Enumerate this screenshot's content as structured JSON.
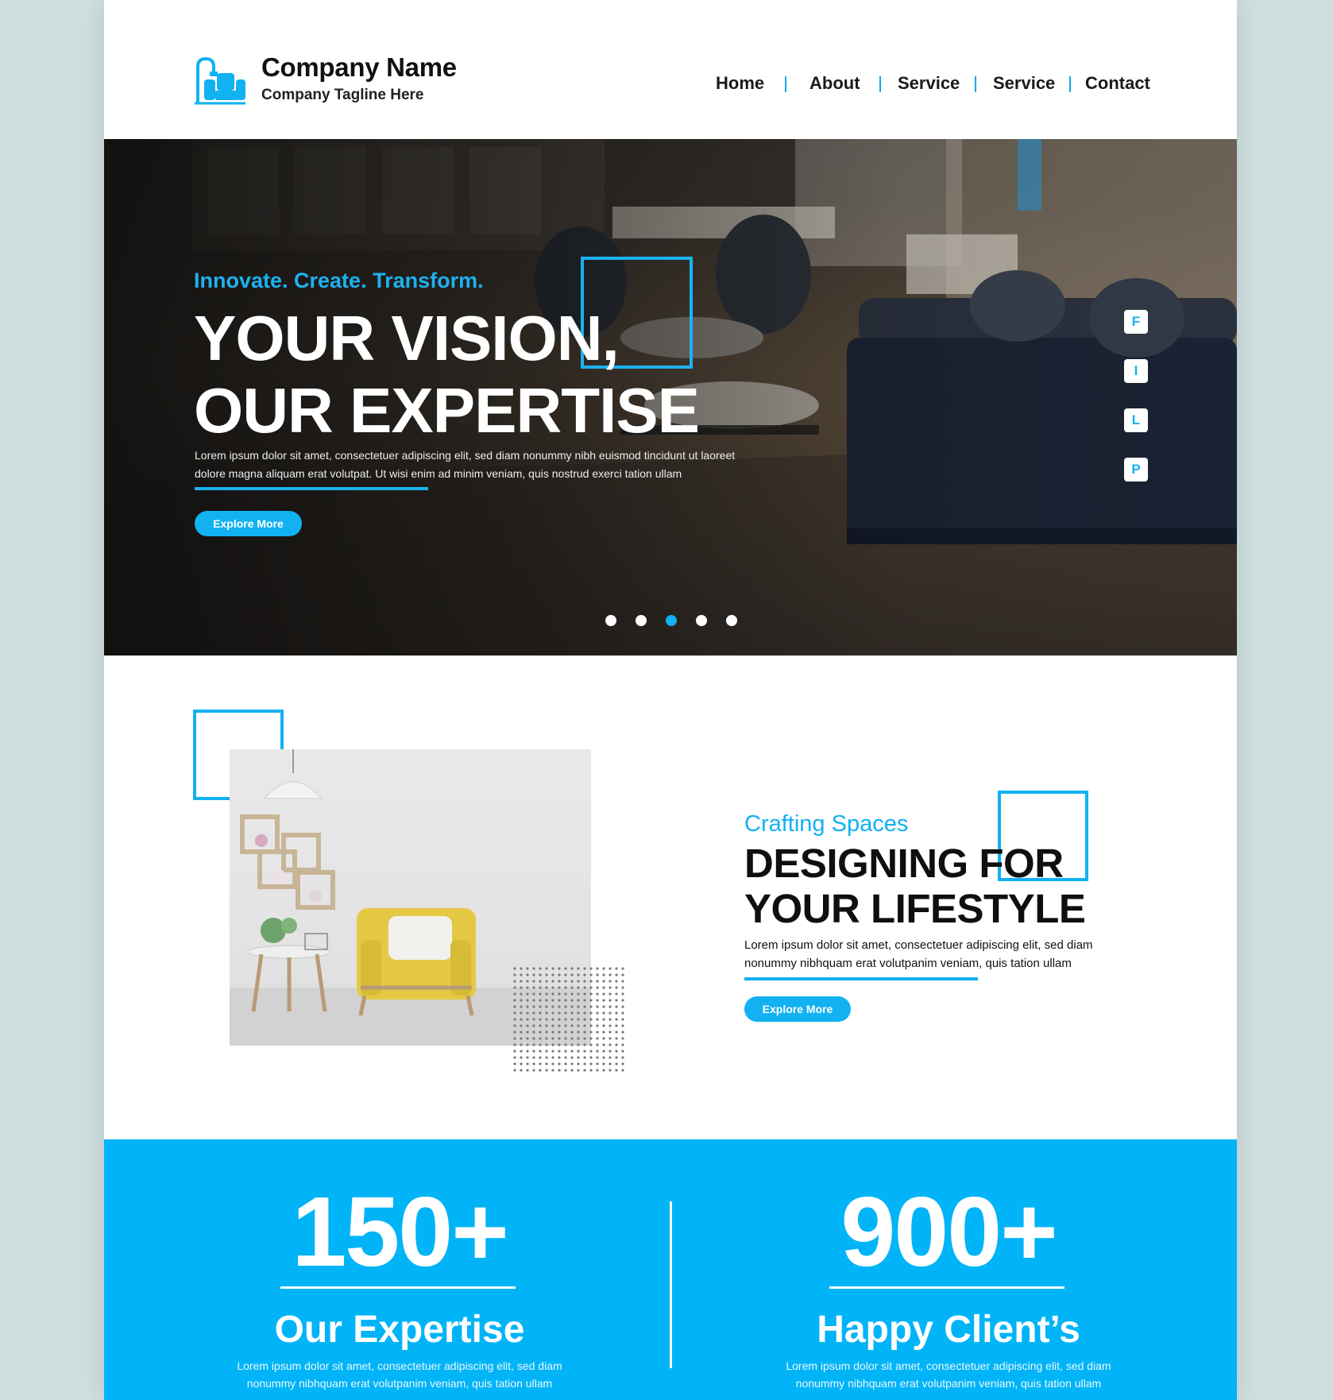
{
  "header": {
    "company_name": "Company Name",
    "tagline": "Company Tagline Here",
    "nav": [
      "Home",
      "About",
      "Service",
      "Service",
      "Contact"
    ]
  },
  "hero": {
    "tagline": "Innovate. Create. Transform.",
    "title_line1": "YOUR VISION,",
    "title_line2": "OUR EXPERTISE",
    "body_line1": "Lorem ipsum dolor sit amet, consectetuer adipiscing elit, sed diam nonummy nibh euismod tincidunt ut laoreet",
    "body_line2": "dolore magna aliquam erat volutpat. Ut wisi enim ad minim veniam, quis nostrud exerci tation ullam",
    "button": "Explore More",
    "social": [
      "F",
      "I",
      "L",
      "P"
    ],
    "slides": 5,
    "active_slide": 3
  },
  "about": {
    "tagline": "Crafting Spaces",
    "title_line1": "DESIGNING FOR",
    "title_line2": "YOUR LIFESTYLE",
    "body_line1": "Lorem ipsum dolor sit amet, consectetuer adipiscing elit, sed diam",
    "body_line2": "nonummy nibhquam erat volutpanim veniam, quis tation ullam",
    "button": "Explore More"
  },
  "stats": [
    {
      "number": "150+",
      "label": "Our Expertise",
      "desc_line1": "Lorem ipsum dolor sit amet, consectetuer adipiscing elit, sed diam",
      "desc_line2": "nonummy nibhquam erat volutpanim veniam, quis tation ullam"
    },
    {
      "number": "900+",
      "label": "Happy Client’s",
      "desc_line1": "Lorem ipsum dolor sit amet, consectetuer adipiscing elit, sed diam",
      "desc_line2": "nonummy nibhquam erat volutpanim veniam, quis tation ullam"
    }
  ],
  "colors": {
    "accent": "#12b1f2",
    "stats_bg": "#00b4f7",
    "page_bg": "#cfdfdf"
  },
  "icons": {
    "logo": "furniture-logo-icon"
  }
}
